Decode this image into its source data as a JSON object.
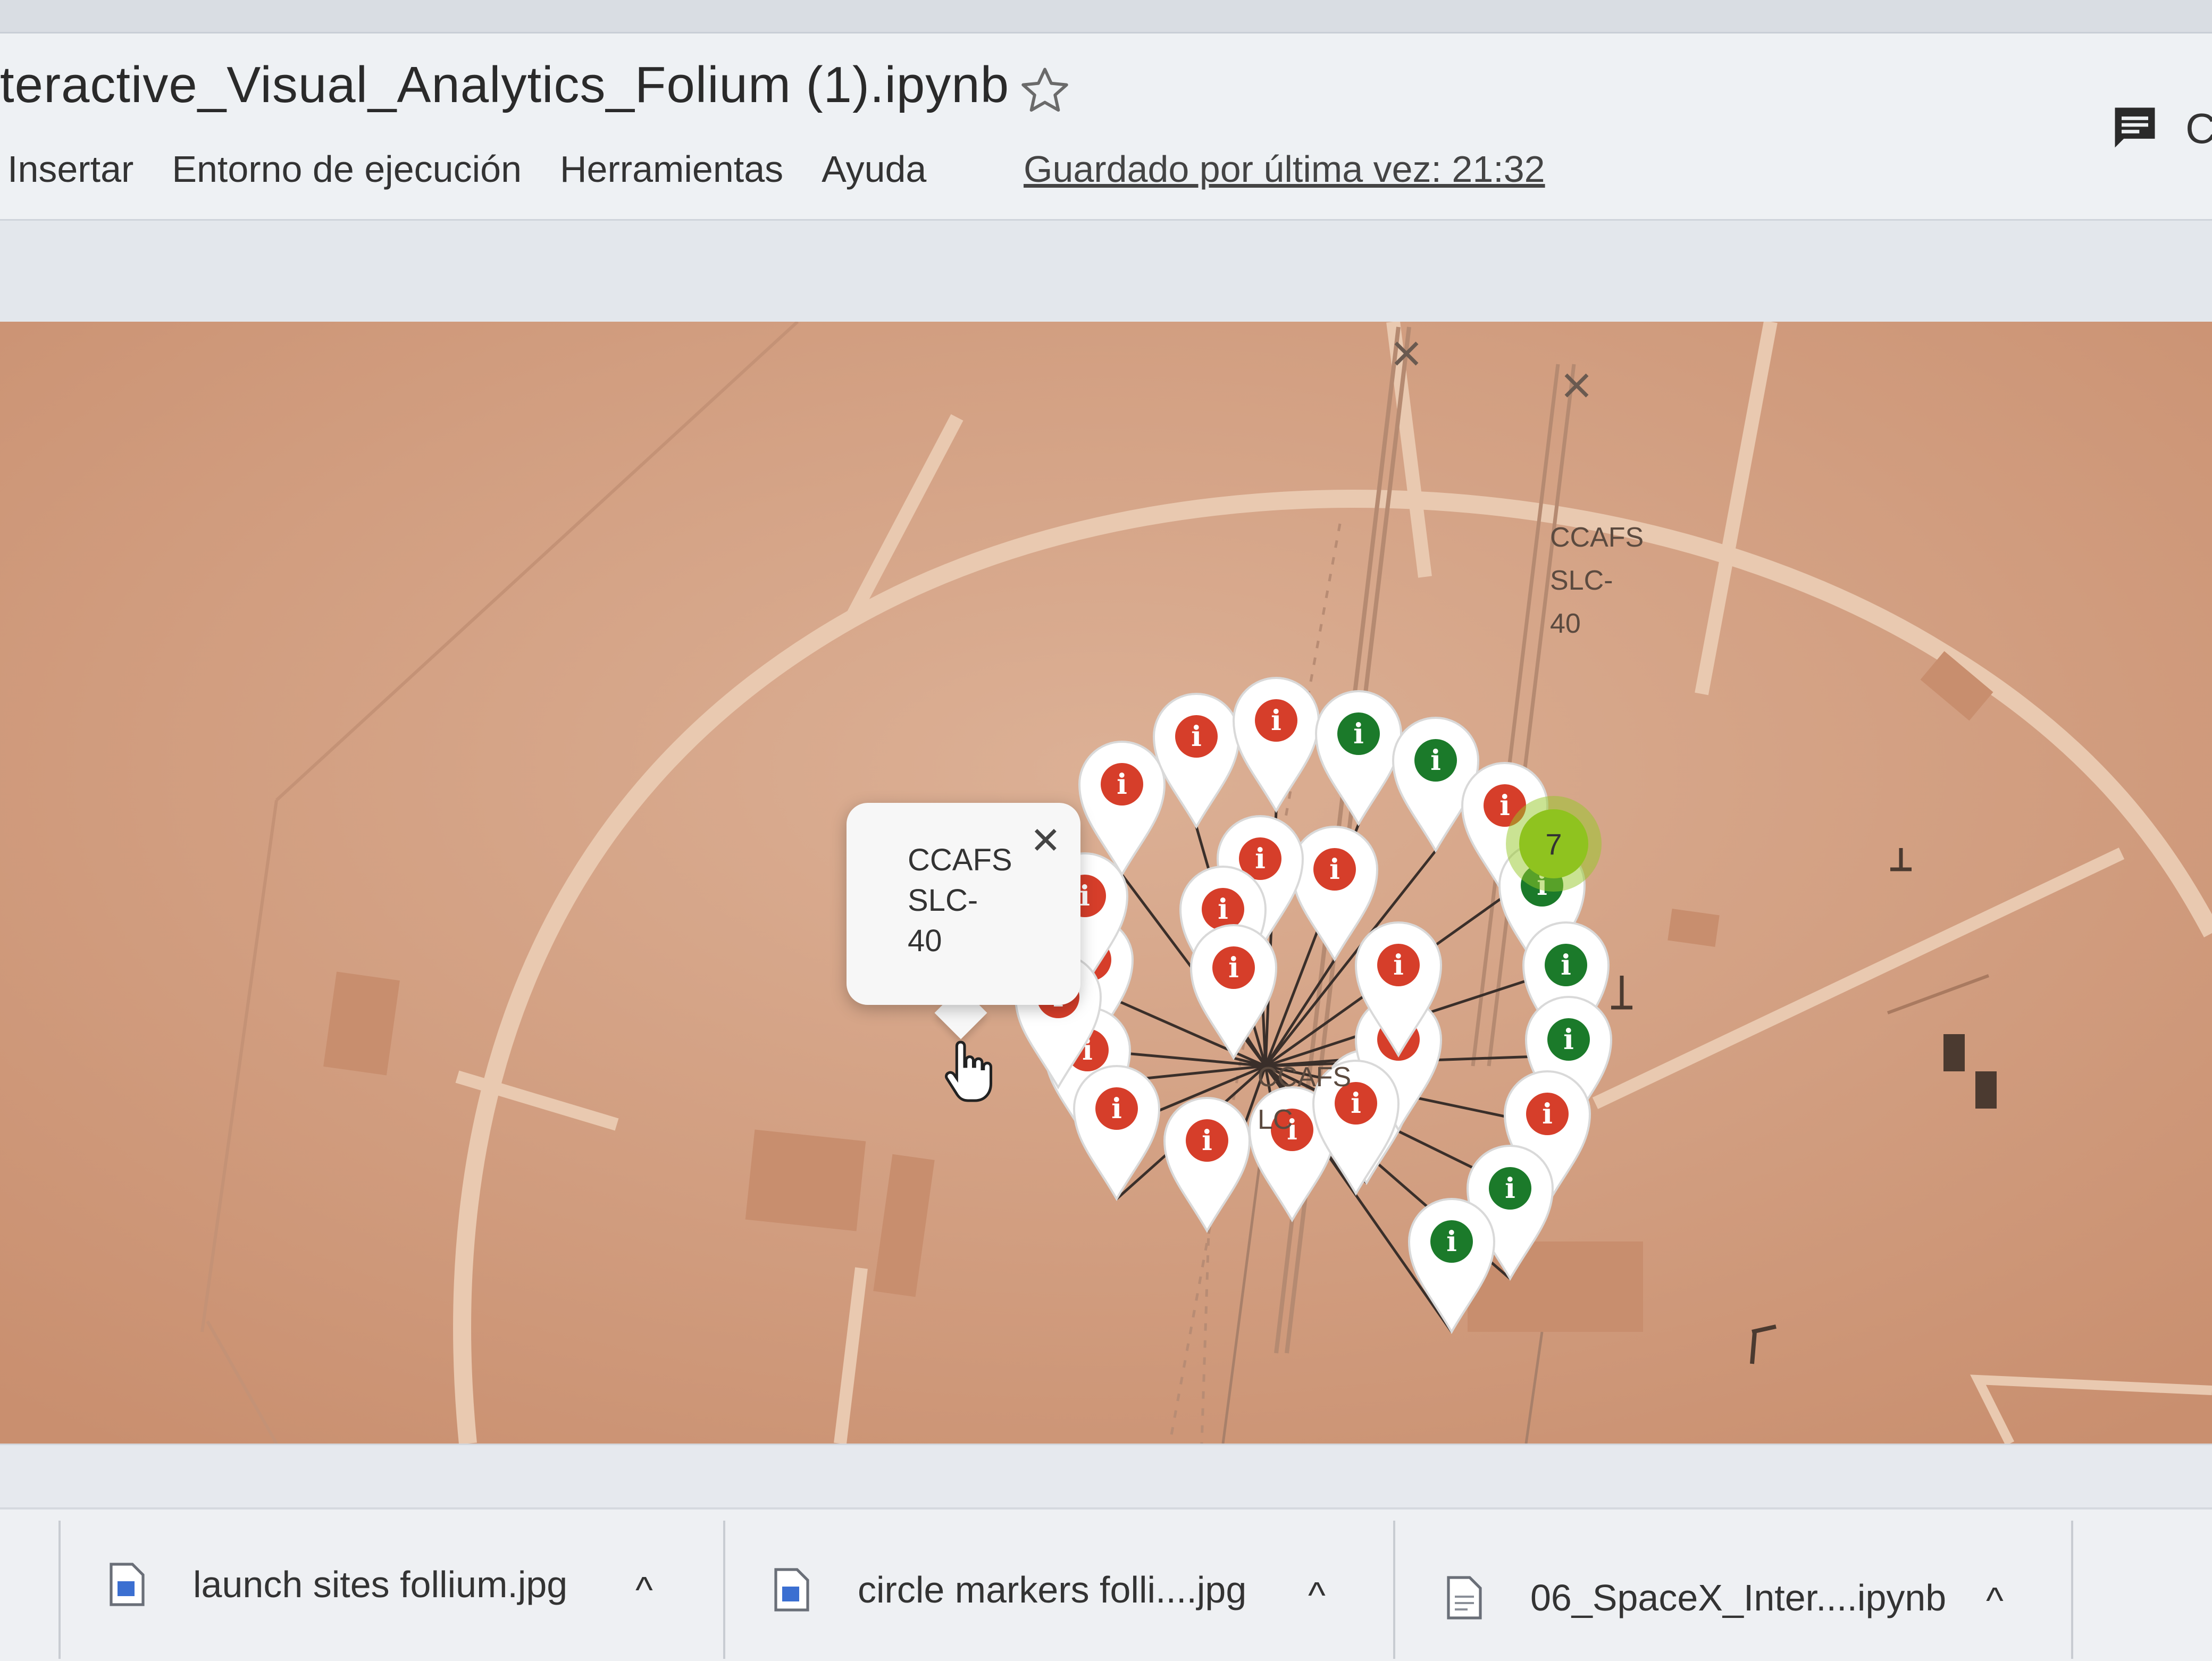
{
  "header": {
    "title": "teractive_Visual_Analytics_Folium (1).ipynb",
    "star_icon": "star-icon",
    "menu": [
      "Insertar",
      "Entorno de ejecución",
      "Herramientas",
      "Ayuda"
    ],
    "saved_status": "Guardado por última vez: 21:32",
    "comment_icon": "comment-icon",
    "comment_letter": "C"
  },
  "map": {
    "cluster_count": "7",
    "cluster_color": "#8fc31f",
    "site_label_lines": [
      "CCAFS",
      "SLC-",
      "40"
    ],
    "center_label": "CCAFS",
    "center_label_sub": "LC",
    "marker_colors": {
      "failure": "#d63e2a",
      "success": "#1b7a2a"
    },
    "popup": {
      "lines": [
        "CCAFS",
        "SLC-",
        "40"
      ],
      "close": "✕"
    }
  },
  "downloads": [
    {
      "name": "launch sites follium.jpg",
      "icon": "image-file-icon"
    },
    {
      "name": "circle markers folli....jpg",
      "icon": "image-file-icon"
    },
    {
      "name": "06_SpaceX_Inter....ipynb",
      "icon": "document-file-icon"
    }
  ],
  "download_chevron": "^"
}
